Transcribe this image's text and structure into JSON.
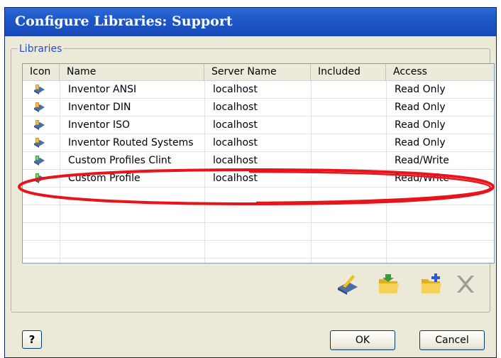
{
  "window": {
    "title": "Configure Libraries: Support"
  },
  "group": {
    "legend": "Libraries"
  },
  "table": {
    "columns": [
      "Icon",
      "Name",
      "Server Name",
      "Included",
      "Access"
    ],
    "rows": [
      {
        "icon": "library-read-icon",
        "name": "Inventor ANSI",
        "server": "localhost",
        "included": "",
        "access": "Read Only"
      },
      {
        "icon": "library-read-icon",
        "name": "Inventor DIN",
        "server": "localhost",
        "included": "",
        "access": "Read Only"
      },
      {
        "icon": "library-read-icon",
        "name": "Inventor ISO",
        "server": "localhost",
        "included": "",
        "access": "Read Only"
      },
      {
        "icon": "library-read-icon",
        "name": "Inventor Routed Systems",
        "server": "localhost",
        "included": "",
        "access": "Read Only"
      },
      {
        "icon": "library-write-icon",
        "name": "Custom Profiles Clint",
        "server": "localhost",
        "included": "",
        "access": "Read/Write"
      },
      {
        "icon": "library-write-icon",
        "name": "Custom Profile",
        "server": "localhost",
        "included": "",
        "access": "Read/Write"
      }
    ]
  },
  "toolbar": {
    "icons": [
      "edit-library-icon",
      "open-library-icon",
      "add-library-icon",
      "delete-icon"
    ]
  },
  "buttons": {
    "help": "?",
    "ok": "OK",
    "cancel": "Cancel"
  },
  "colors": {
    "annotation": "#e8141c",
    "title_bar": "#1e58c9"
  }
}
